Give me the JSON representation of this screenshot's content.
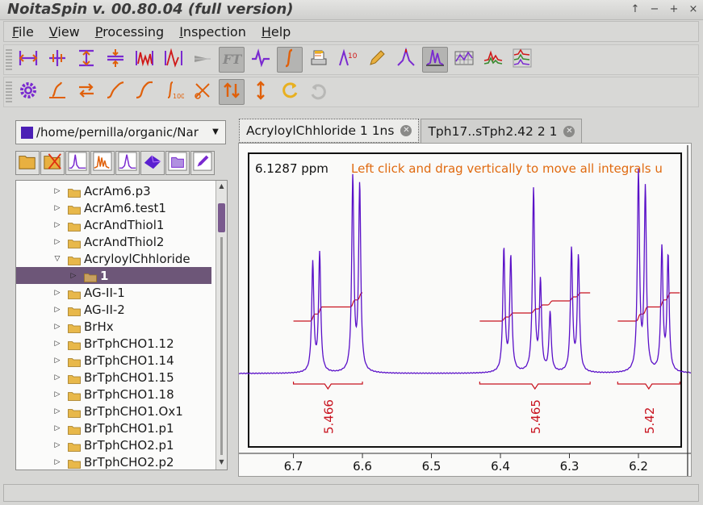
{
  "window": {
    "title": "NoitaSpin v. 00.80.04 (full version)",
    "buttons": [
      "↑",
      "−",
      "+",
      "×"
    ]
  },
  "menu": [
    {
      "label": "File",
      "key": "F",
      "rest": "ile"
    },
    {
      "label": "View",
      "key": "V",
      "rest": "iew"
    },
    {
      "label": "Processing",
      "key": "P",
      "rest": "rocessing"
    },
    {
      "label": "Inspection",
      "key": "I",
      "rest": "nspection"
    },
    {
      "label": "Help",
      "key": "H",
      "rest": "elp"
    }
  ],
  "toolbar1": [
    {
      "name": "align-edges-icon",
      "active": false
    },
    {
      "name": "align-center-icon",
      "active": false
    },
    {
      "name": "vertical-range-icon",
      "active": false
    },
    {
      "name": "compress-vertical-icon",
      "active": false
    },
    {
      "name": "spectrum-range-icon",
      "active": false
    },
    {
      "name": "peak-range-icon",
      "active": false
    },
    {
      "name": "pointer-icon",
      "active": false
    },
    {
      "name": "fourier-transform-icon",
      "active": true,
      "text": "FT"
    },
    {
      "name": "phase-icon",
      "active": false
    },
    {
      "name": "integral-icon",
      "active": true
    },
    {
      "name": "print-icon",
      "active": false
    },
    {
      "name": "peak-label-icon",
      "active": false
    },
    {
      "name": "pencil-icon",
      "active": false
    },
    {
      "name": "peak-pick-icon",
      "active": false
    },
    {
      "name": "spectrum-view-icon",
      "active": true
    },
    {
      "name": "grid-icon",
      "active": false
    },
    {
      "name": "multi-spectrum-icon",
      "active": false
    },
    {
      "name": "stacked-spectra-icon",
      "active": false
    }
  ],
  "toolbar2": [
    {
      "name": "settings-gear-icon",
      "active": false
    },
    {
      "name": "baseline-icon",
      "active": false
    },
    {
      "name": "swap-icon",
      "active": false
    },
    {
      "name": "slope-icon",
      "active": false
    },
    {
      "name": "sigmoid-icon",
      "active": false
    },
    {
      "name": "integral-range-icon",
      "active": false
    },
    {
      "name": "cut-icon",
      "active": false
    },
    {
      "name": "updown-arrows-icon",
      "active": true
    },
    {
      "name": "vertical-arrow-icon",
      "active": false
    },
    {
      "name": "rotate-icon",
      "active": false
    },
    {
      "name": "undo-icon",
      "active": false
    }
  ],
  "path": {
    "value": "/home/pernilla/organic/Nar"
  },
  "file_icons": [
    "open-folder-icon",
    "delete-folder-icon",
    "spectrum-1d-icon",
    "multi-peaks-icon",
    "spectrum-alt-icon",
    "surface-3d-icon",
    "folder-alt-icon",
    "edit-icon"
  ],
  "tree": {
    "items": [
      {
        "label": "AcrAm6.p3",
        "level": 0,
        "expanded": false,
        "selected": false
      },
      {
        "label": "AcrAm6.test1",
        "level": 0,
        "expanded": false,
        "selected": false
      },
      {
        "label": "AcrAndThiol1",
        "level": 0,
        "expanded": false,
        "selected": false
      },
      {
        "label": "AcrAndThiol2",
        "level": 0,
        "expanded": false,
        "selected": false
      },
      {
        "label": "AcryloylChhloride",
        "level": 0,
        "expanded": true,
        "selected": false
      },
      {
        "label": "1",
        "level": 1,
        "expanded": false,
        "selected": true
      },
      {
        "label": "AG-II-1",
        "level": 0,
        "expanded": false,
        "selected": false
      },
      {
        "label": "AG-II-2",
        "level": 0,
        "expanded": false,
        "selected": false
      },
      {
        "label": "BrHx",
        "level": 0,
        "expanded": false,
        "selected": false
      },
      {
        "label": "BrTphCHO1.12",
        "level": 0,
        "expanded": false,
        "selected": false
      },
      {
        "label": "BrTphCHO1.14",
        "level": 0,
        "expanded": false,
        "selected": false
      },
      {
        "label": "BrTphCHO1.15",
        "level": 0,
        "expanded": false,
        "selected": false
      },
      {
        "label": "BrTphCHO1.18",
        "level": 0,
        "expanded": false,
        "selected": false
      },
      {
        "label": "BrTphCHO1.Ox1",
        "level": 0,
        "expanded": false,
        "selected": false
      },
      {
        "label": "BrTphCHO1.p1",
        "level": 0,
        "expanded": false,
        "selected": false
      },
      {
        "label": "BrTphCHO2.p1",
        "level": 0,
        "expanded": false,
        "selected": false
      },
      {
        "label": "BrTphCHO2.p2",
        "level": 0,
        "expanded": false,
        "selected": false
      }
    ]
  },
  "tabs": [
    {
      "label": "AcryloylChhloride 1 1ns",
      "active": true
    },
    {
      "label": "Tph17..sTph2.42 2 1",
      "active": false
    }
  ],
  "spectrum": {
    "cursor_readout": "6.1287 ppm",
    "hint": "Left click and drag vertically to move all integrals u",
    "x_ticks": [
      "6.7",
      "6.6",
      "6.5",
      "6.4",
      "6.3",
      "6.2"
    ],
    "x_min": 6.138,
    "x_max": 6.765,
    "peaks": [
      {
        "ppm": 6.672,
        "h": 0.55
      },
      {
        "ppm": 6.662,
        "h": 0.6
      },
      {
        "ppm": 6.614,
        "h": 0.98
      },
      {
        "ppm": 6.604,
        "h": 0.94
      },
      {
        "ppm": 6.395,
        "h": 0.62
      },
      {
        "ppm": 6.385,
        "h": 0.58
      },
      {
        "ppm": 6.352,
        "h": 0.92
      },
      {
        "ppm": 6.342,
        "h": 0.45
      },
      {
        "ppm": 6.328,
        "h": 0.3
      },
      {
        "ppm": 6.297,
        "h": 0.62
      },
      {
        "ppm": 6.287,
        "h": 0.58
      },
      {
        "ppm": 6.2,
        "h": 1.0
      },
      {
        "ppm": 6.19,
        "h": 0.92
      },
      {
        "ppm": 6.166,
        "h": 0.62
      },
      {
        "ppm": 6.157,
        "h": 0.58
      }
    ],
    "integrals": [
      {
        "label": "5.466",
        "from": 6.7,
        "to": 6.6
      },
      {
        "label": "5.465",
        "from": 6.43,
        "to": 6.27
      },
      {
        "label": "5.42",
        "from": 6.23,
        "to": 6.14
      }
    ],
    "colors": {
      "spectrum": "#5a10c8",
      "integral": "#c81420",
      "hint": "#e06a10",
      "cursor": "#2a2a2a"
    }
  }
}
